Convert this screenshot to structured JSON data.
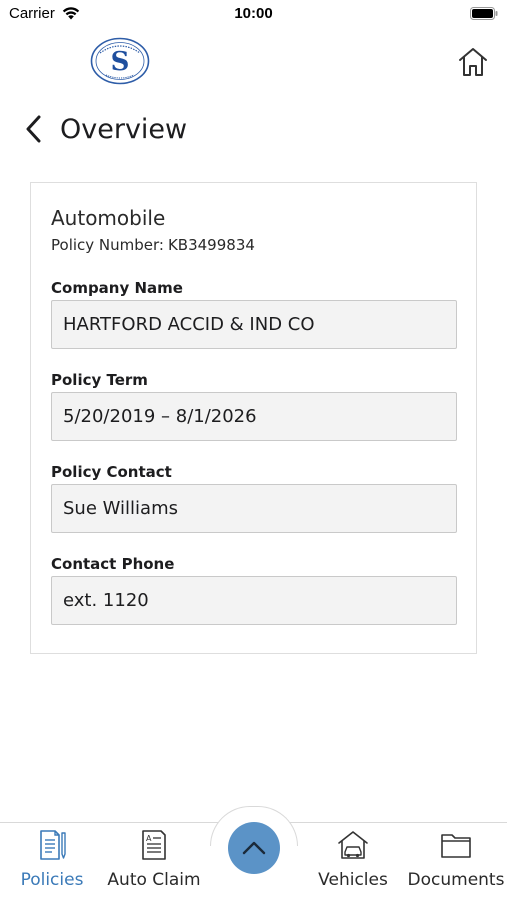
{
  "status_bar": {
    "carrier": "Carrier",
    "time": "10:00"
  },
  "header": {
    "logo_icon": "company-seal-logo",
    "home_icon": "home-icon"
  },
  "nav": {
    "title": "Overview",
    "back_icon": "chevron-left-icon"
  },
  "policy": {
    "type": "Automobile",
    "number_label": "Policy Number:",
    "number": "KB3499834",
    "fields": [
      {
        "label": "Company Name",
        "value": "HARTFORD ACCID & IND CO"
      },
      {
        "label": "Policy Term",
        "value": "5/20/2019 – 8/1/2026"
      },
      {
        "label": "Policy Contact",
        "value": "Sue Williams"
      },
      {
        "label": "Contact Phone",
        "value": "ext. 1120"
      }
    ]
  },
  "tabs": [
    {
      "label": "Policies",
      "icon": "policies-document-icon",
      "active": true
    },
    {
      "label": "Auto Claim",
      "icon": "auto-claim-form-icon",
      "active": false
    },
    {
      "label": "Vehicles",
      "icon": "vehicle-garage-icon",
      "active": false
    },
    {
      "label": "Documents",
      "icon": "folder-icon",
      "active": false
    }
  ],
  "fab": {
    "icon": "chevron-up-icon"
  },
  "colors": {
    "accent": "#3b7ab8",
    "fab": "#5b93c7",
    "field_bg": "#f3f3f3",
    "border": "#dedede"
  }
}
